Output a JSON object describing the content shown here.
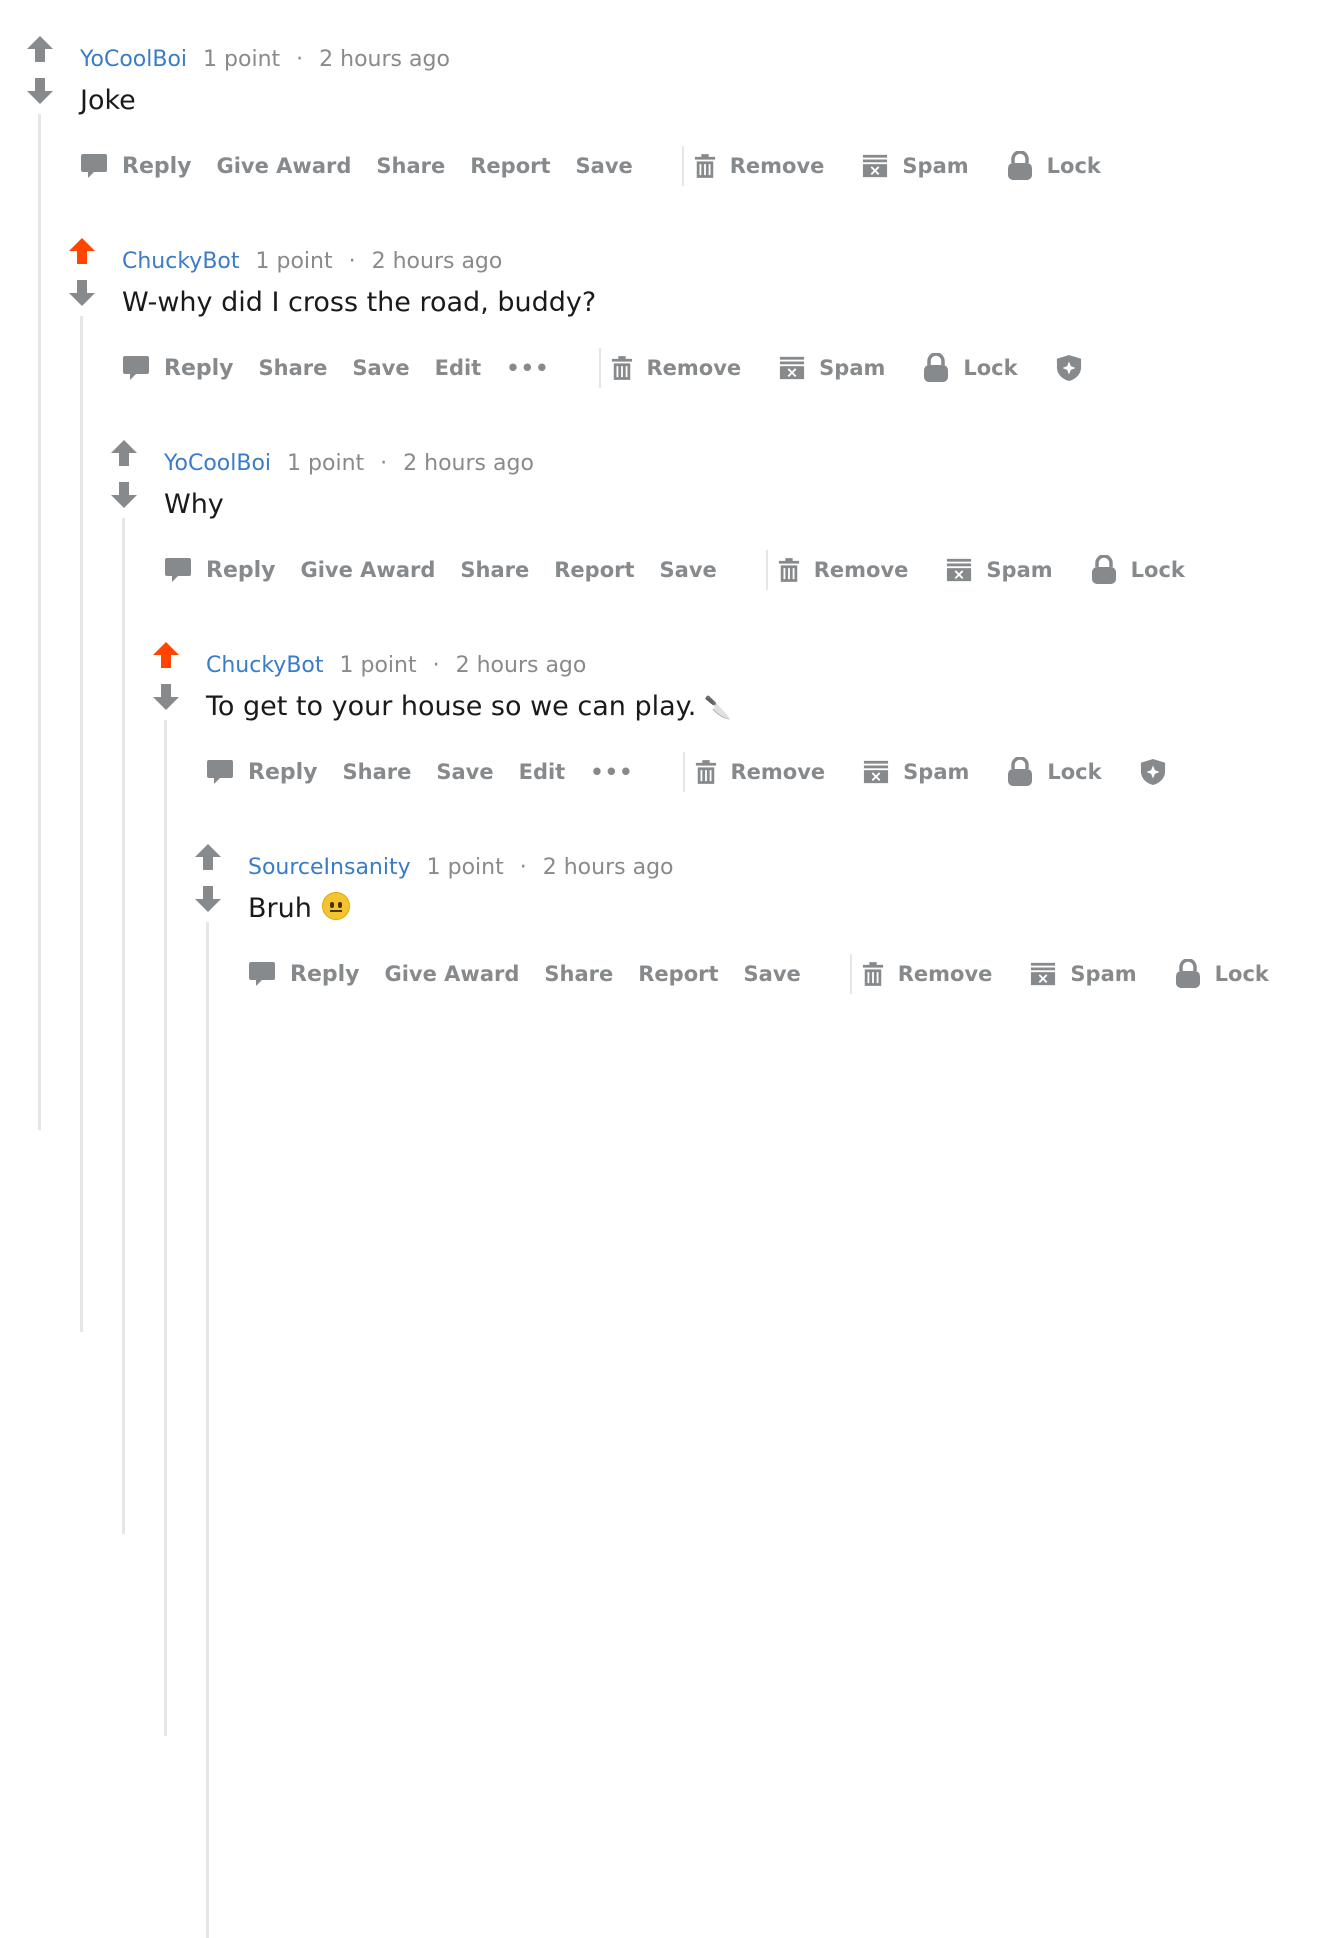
{
  "colors": {
    "author": "#3a7cc7",
    "meta": "#8a8a8a",
    "action": "#878a8c",
    "upvoted": "#ff4500",
    "vote_neutral": "#878a8c",
    "thread_line": "#e6e6e6"
  },
  "comments": [
    {
      "author": "YoCoolBoi",
      "points": "1 point",
      "separator": "·",
      "time": "2 hours ago",
      "body": "Joke",
      "upvoted": false,
      "actions": {
        "reply": "Reply",
        "give_award": "Give Award",
        "share": "Share",
        "report": "Report",
        "save": "Save"
      },
      "mod_actions": {
        "remove": "Remove",
        "spam": "Spam",
        "lock": "Lock"
      }
    },
    {
      "author": "ChuckyBot",
      "points": "1 point",
      "separator": "·",
      "time": "2 hours ago",
      "body": "W-why did I cross the road, buddy?",
      "upvoted": true,
      "actions": {
        "reply": "Reply",
        "share": "Share",
        "save": "Save",
        "edit": "Edit",
        "more": "•••"
      },
      "mod_actions": {
        "remove": "Remove",
        "spam": "Spam",
        "lock": "Lock"
      }
    },
    {
      "author": "YoCoolBoi",
      "points": "1 point",
      "separator": "·",
      "time": "2 hours ago",
      "body": "Why",
      "upvoted": false,
      "actions": {
        "reply": "Reply",
        "give_award": "Give Award",
        "share": "Share",
        "report": "Report",
        "save": "Save"
      },
      "mod_actions": {
        "remove": "Remove",
        "spam": "Spam",
        "lock": "Lock"
      }
    },
    {
      "author": "ChuckyBot",
      "points": "1 point",
      "separator": "·",
      "time": "2 hours ago",
      "body": "To get to your house so we can play.",
      "body_emoji": "🔪",
      "upvoted": true,
      "actions": {
        "reply": "Reply",
        "share": "Share",
        "save": "Save",
        "edit": "Edit",
        "more": "•••"
      },
      "mod_actions": {
        "remove": "Remove",
        "spam": "Spam",
        "lock": "Lock"
      }
    },
    {
      "author": "SourceInsanity",
      "points": "1 point",
      "separator": "·",
      "time": "2 hours ago",
      "body": "Bruh",
      "body_emoji_name": "neutral-face-emoji",
      "upvoted": false,
      "actions": {
        "reply": "Reply",
        "give_award": "Give Award",
        "share": "Share",
        "report": "Report",
        "save": "Save"
      },
      "mod_actions": {
        "remove": "Remove",
        "spam": "Spam",
        "lock": "Lock"
      }
    }
  ]
}
